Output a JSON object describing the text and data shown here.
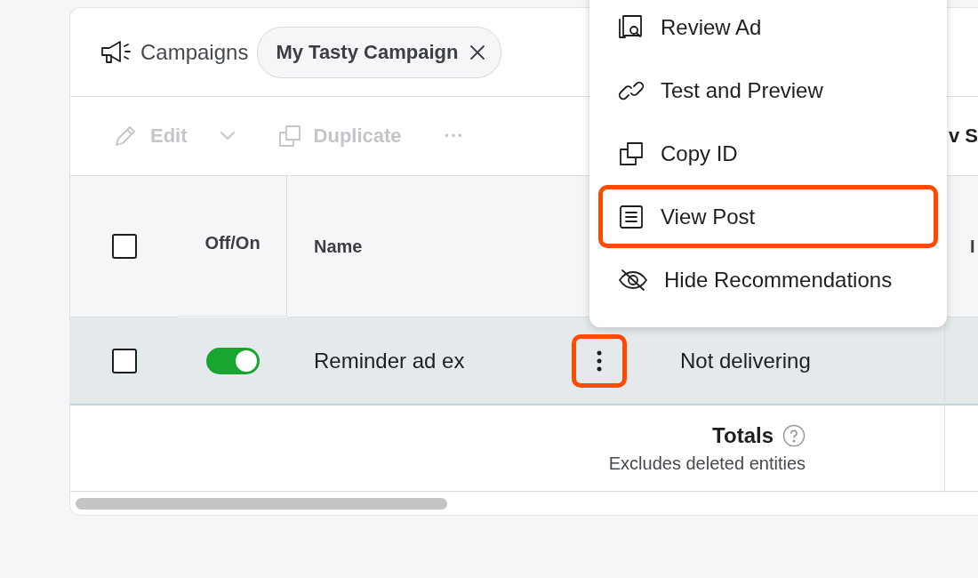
{
  "header": {
    "title": "Campaigns",
    "filter_chip": "My Tasty Campaign"
  },
  "toolbar": {
    "buttons": [
      {
        "kind": "edit",
        "label": "Edit",
        "disabled": true
      },
      {
        "kind": "duplicate",
        "label": "Duplicate",
        "disabled": true
      },
      {
        "kind": "more",
        "label": "···",
        "disabled": true
      }
    ],
    "cut_text": "v S"
  },
  "table": {
    "select_all_checked": false,
    "columns": [
      {
        "label": "Off/On"
      },
      {
        "label": "Name"
      },
      {
        "label": "I"
      }
    ],
    "rows": [
      {
        "checked": false,
        "on": true,
        "highlighted": true,
        "name": "Reminder ad ex",
        "actions_highlighted": true,
        "status": "Not delivering"
      }
    ],
    "totals": {
      "label": "Totals",
      "note": "Excludes deleted entities"
    }
  },
  "menu": {
    "items": [
      {
        "kind": "review",
        "label": "Review Ad",
        "highlighted": false
      },
      {
        "kind": "link",
        "label": "Test and Preview",
        "highlighted": false
      },
      {
        "kind": "copy",
        "label": "Copy ID",
        "highlighted": false
      },
      {
        "kind": "post",
        "label": "View Post",
        "highlighted": true
      },
      {
        "kind": "hide",
        "label": "Hide Recommendations",
        "highlighted": false
      }
    ]
  }
}
